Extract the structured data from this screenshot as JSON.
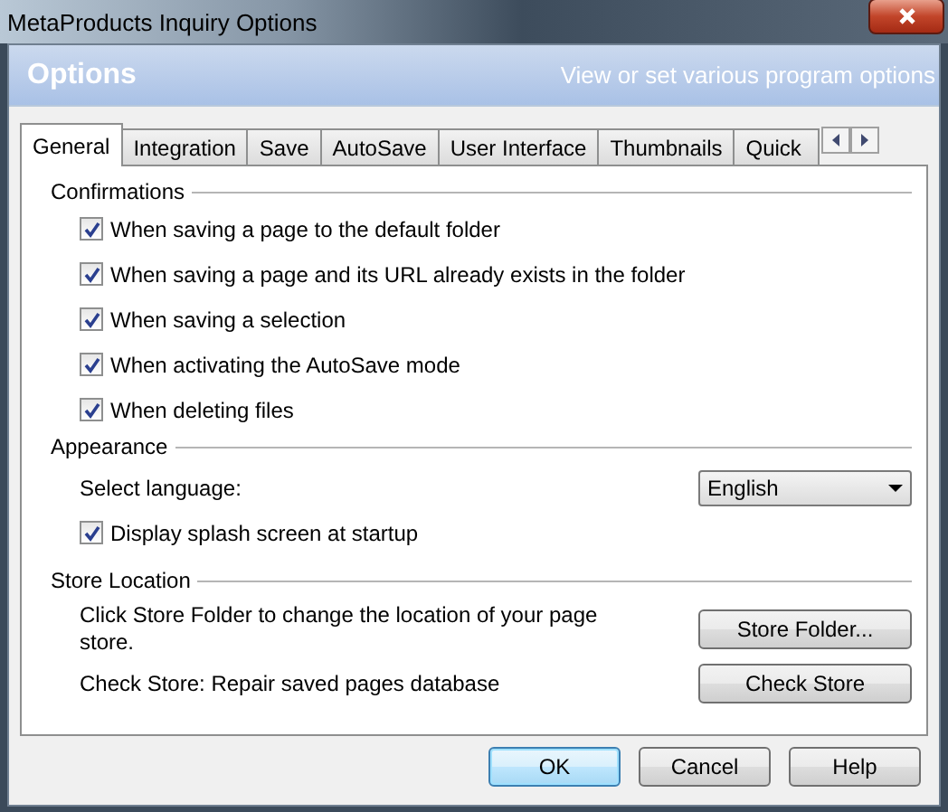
{
  "window": {
    "title": "MetaProducts Inquiry Options"
  },
  "banner": {
    "title": "Options",
    "subtitle": "View or set various program options"
  },
  "tabs": [
    {
      "label": "General",
      "selected": true
    },
    {
      "label": "Integration",
      "selected": false
    },
    {
      "label": "Save",
      "selected": false
    },
    {
      "label": "AutoSave",
      "selected": false
    },
    {
      "label": "User Interface",
      "selected": false
    },
    {
      "label": "Thumbnails",
      "selected": false
    },
    {
      "label": "Quick",
      "selected": false
    }
  ],
  "confirmations": {
    "heading": "Confirmations",
    "items": [
      {
        "label": "When saving a page to the default folder",
        "checked": true
      },
      {
        "label": "When saving a page and its URL already exists in the folder",
        "checked": true
      },
      {
        "label": "When saving a selection",
        "checked": true
      },
      {
        "label": "When activating the AutoSave mode",
        "checked": true
      },
      {
        "label": "When deleting files",
        "checked": true
      }
    ]
  },
  "appearance": {
    "heading": "Appearance",
    "language_label": "Select language:",
    "language": "English",
    "splash": {
      "label": "Display splash screen at startup",
      "checked": true
    }
  },
  "store": {
    "heading": "Store Location",
    "rows": [
      {
        "text": "Click Store Folder to change the location of your page store.",
        "button": "Store Folder..."
      },
      {
        "text": "Check Store: Repair saved pages database",
        "button": "Check Store"
      }
    ]
  },
  "buttons": [
    {
      "label": "OK",
      "default": true
    },
    {
      "label": "Cancel",
      "default": false
    },
    {
      "label": "Help",
      "default": false
    }
  ]
}
